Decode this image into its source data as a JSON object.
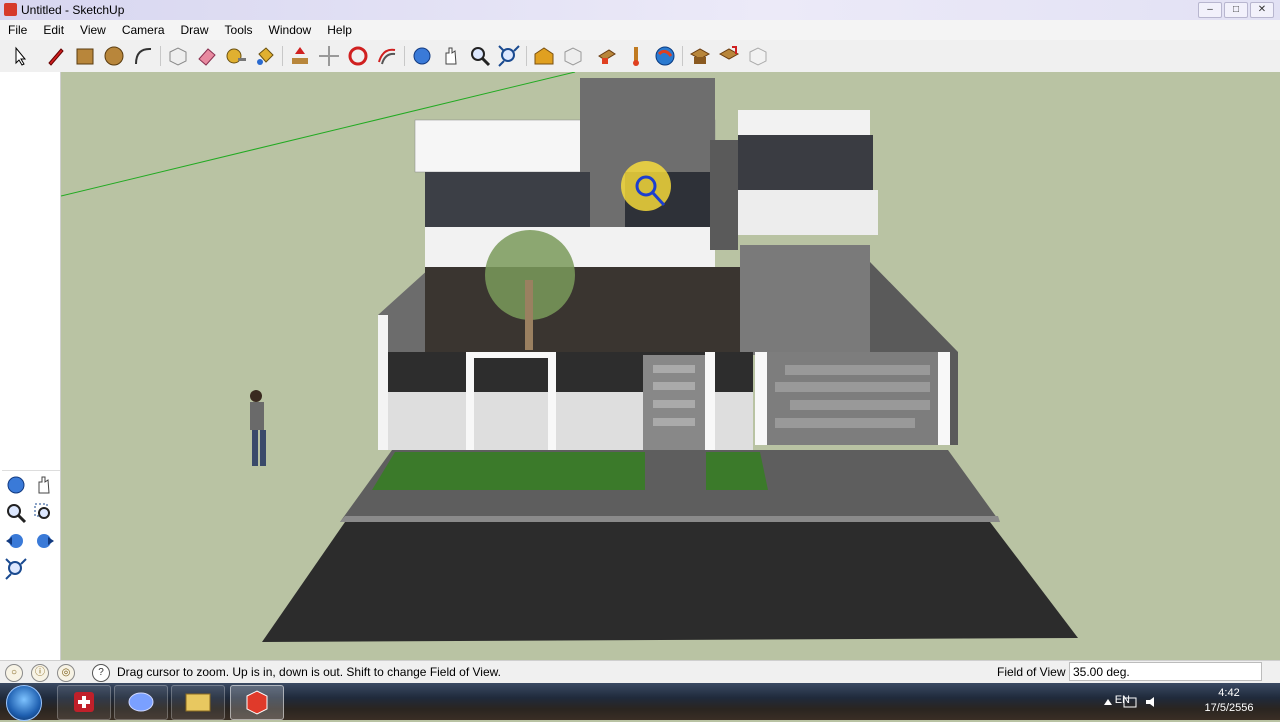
{
  "window": {
    "title": "Untitled - SketchUp",
    "controls": [
      "minimize",
      "maximize",
      "close"
    ]
  },
  "menu": [
    "File",
    "Edit",
    "View",
    "Camera",
    "Draw",
    "Tools",
    "Window",
    "Help"
  ],
  "toolbar": {
    "tools": [
      "select-icon",
      "pencil-icon",
      "rectangle-icon",
      "circle-icon",
      "arc-icon",
      "make-component-icon",
      "eraser-icon",
      "tape-measure-icon",
      "paint-bucket-icon",
      "push-pull-icon",
      "move-icon",
      "rotate-icon",
      "offset-icon",
      "orbit-icon",
      "pan-icon",
      "zoom-icon",
      "zoom-extents-icon",
      "warehouse-icon",
      "share-model-icon",
      "component-icon",
      "get-photo-texture-icon",
      "geo-location-icon",
      "extension-warehouse-icon",
      "send-to-layout-icon",
      "export-icon"
    ]
  },
  "camera_palette": [
    "orbit-icon",
    "pan-icon",
    "zoom-icon",
    "zoom-window-icon",
    "previous-view-icon",
    "next-view-icon",
    "zoom-extents-icon"
  ],
  "status": {
    "hint": "Drag cursor to zoom.  Up is in, down is out. Shift to change Field of View.",
    "vcb_label": "Field of View",
    "vcb_value": "35.00 deg."
  },
  "taskbar": {
    "apps": [
      "add-app-icon",
      "browser-icon",
      "file-explorer-icon",
      "sketchup-icon"
    ],
    "language": "EN",
    "time": "4:42",
    "date": "17/5/2556"
  },
  "colors": {
    "sky": "#b9c3a3",
    "wall": "#ffffff",
    "stone": "#6b6b6b",
    "grass": "#3b7a2a",
    "road": "#2c2c2c",
    "axis_green": "#22aa22"
  }
}
